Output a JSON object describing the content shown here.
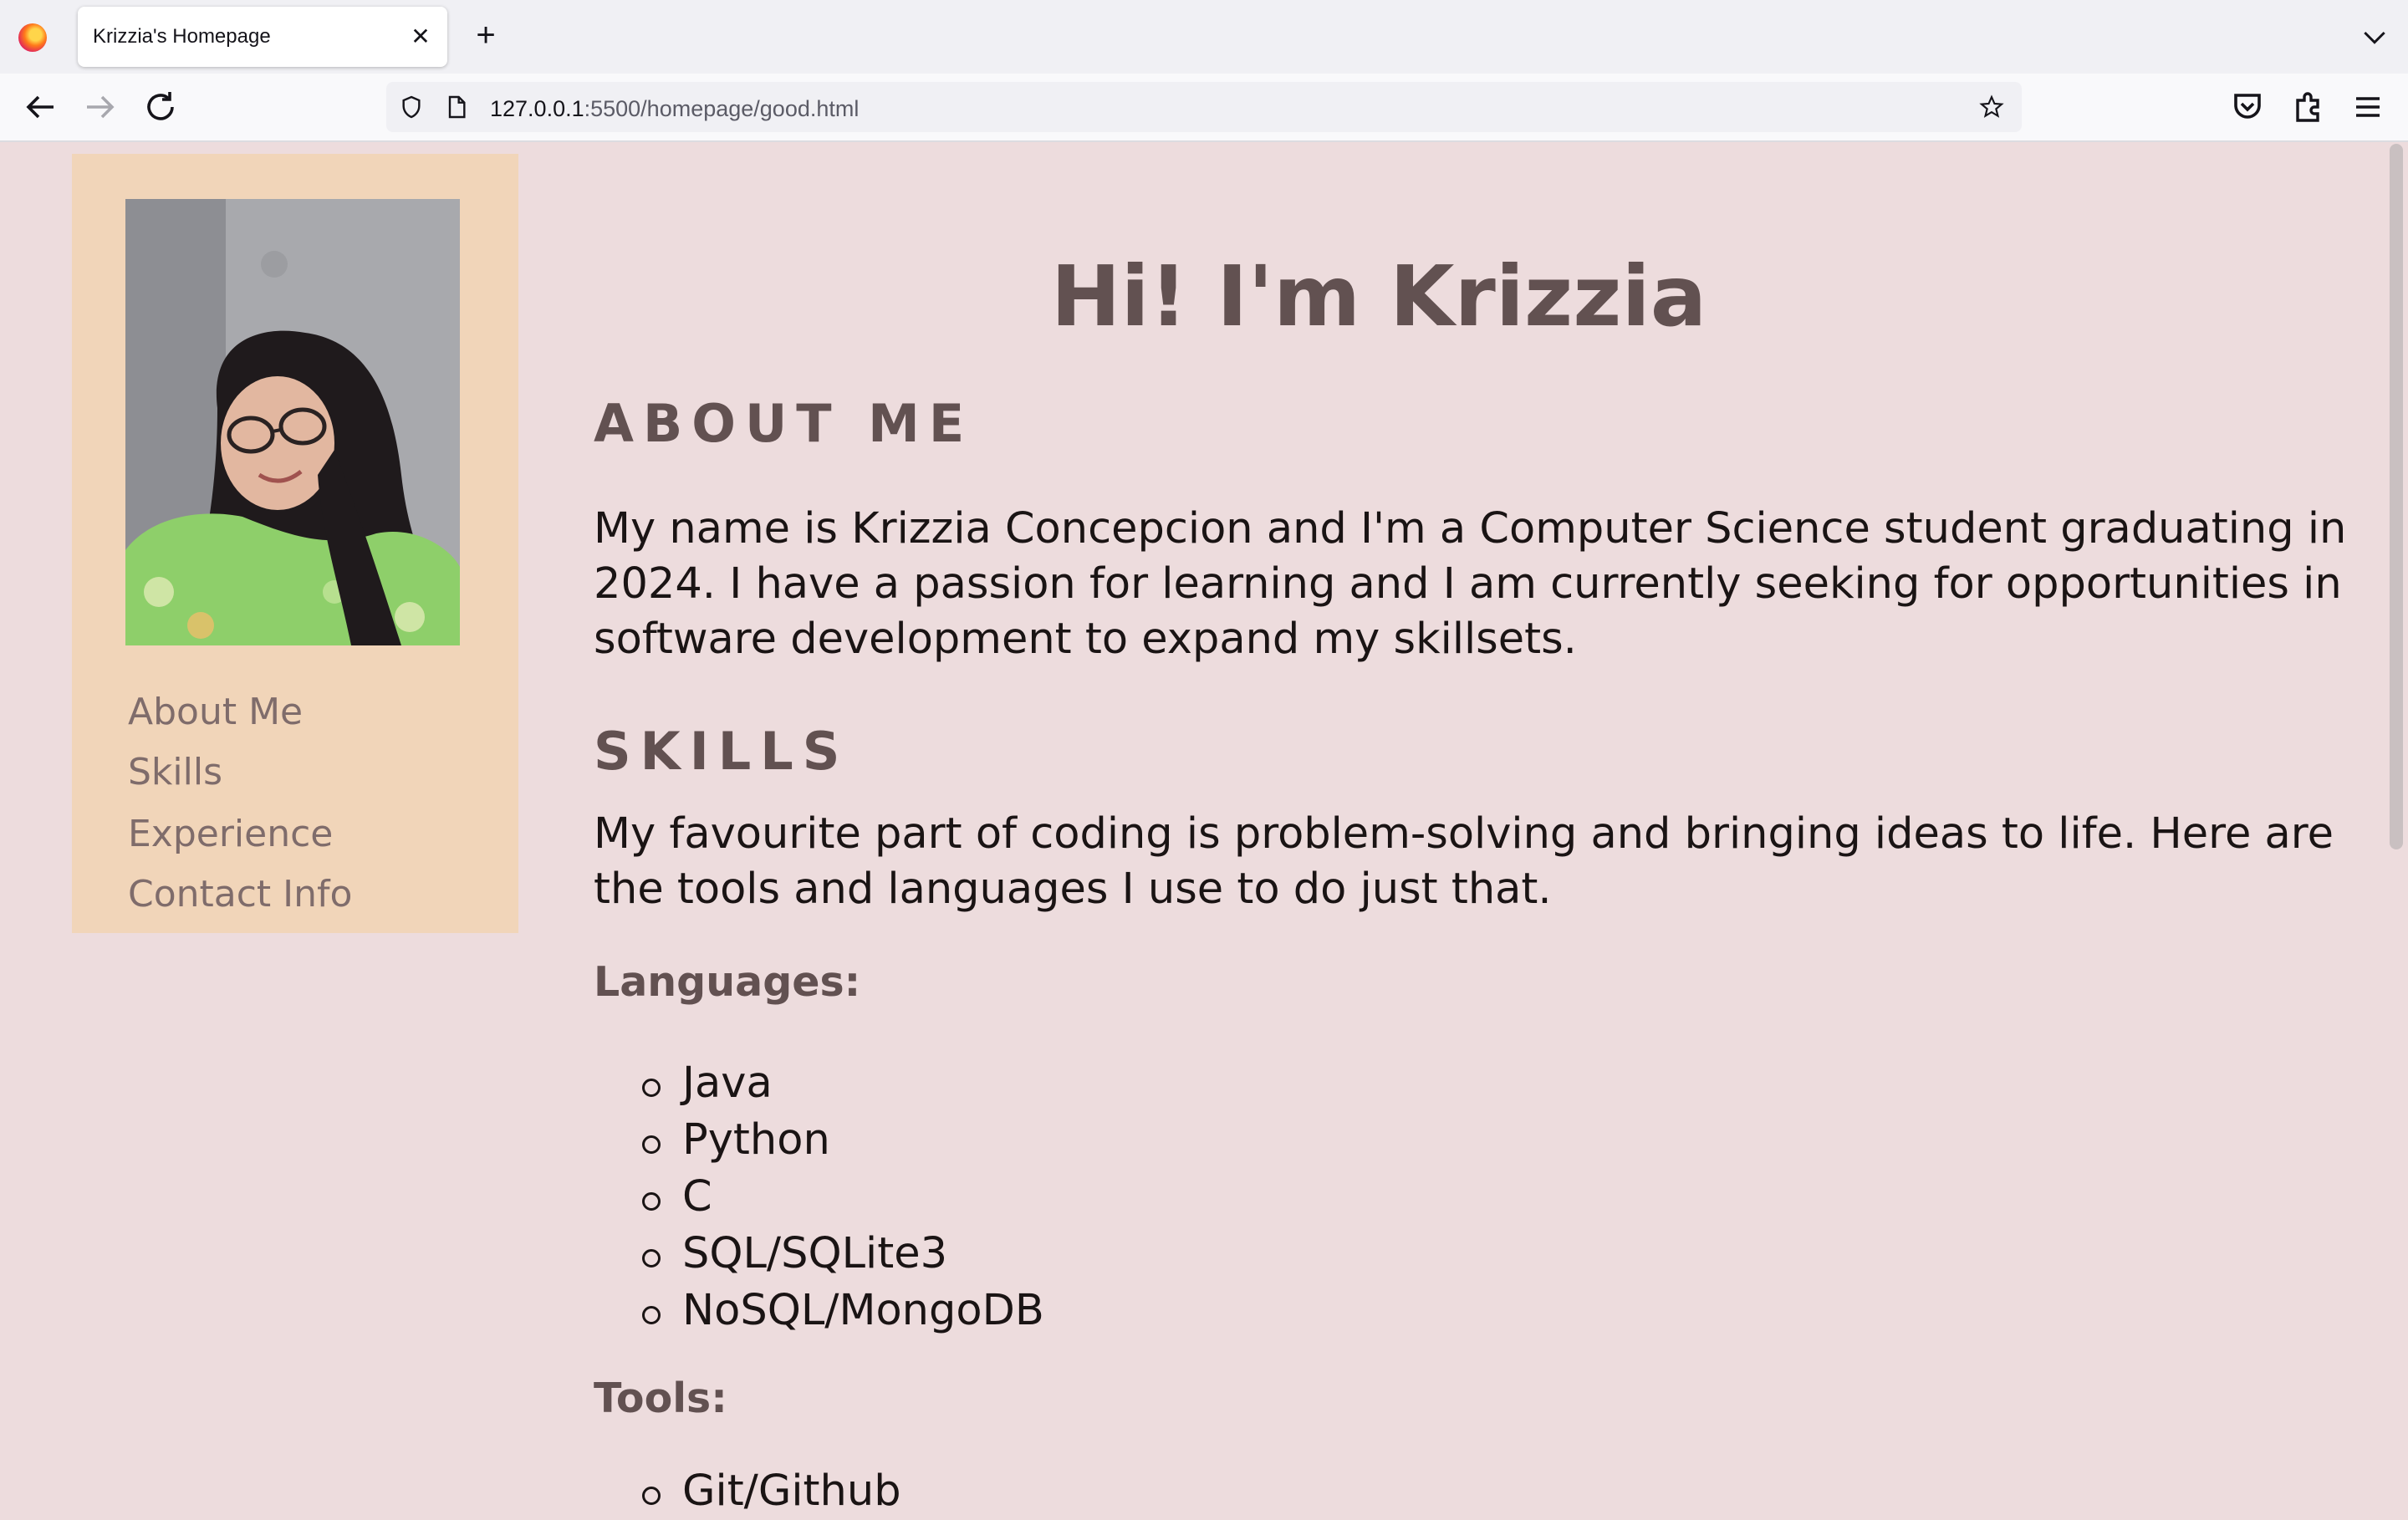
{
  "browser": {
    "tab_title": "Krizzia's Homepage",
    "url_host": "127.0.0.1",
    "url_rest": ":5500/homepage/good.html"
  },
  "sidebar": {
    "nav": [
      {
        "label": "About Me"
      },
      {
        "label": "Skills"
      },
      {
        "label": "Experience"
      },
      {
        "label": "Contact Info"
      }
    ]
  },
  "main": {
    "title": "Hi! I'm Krizzia",
    "about": {
      "heading": "ABOUT ME",
      "text": "My name is Krizzia Concepcion and I'm a Computer Science student graduating in 2024. I have a passion for learning and I am currently seeking for opportunities in software development to expand my skillsets."
    },
    "skills": {
      "heading": "SKILLS",
      "text": "My favourite part of coding is problem-solving and bringing ideas to life. Here are the tools and languages I use to do just that.",
      "languages_heading": "Languages:",
      "languages": [
        "Java",
        "Python",
        "C",
        "SQL/SQLite3",
        "NoSQL/MongoDB"
      ],
      "tools_heading": "Tools:",
      "tools": [
        "Git/Github"
      ]
    }
  },
  "colors": {
    "page_bg": "#eddcdd",
    "sidebar_bg": "#f1d5b9",
    "heading": "#625151",
    "nav_link": "#7f6c6b"
  }
}
